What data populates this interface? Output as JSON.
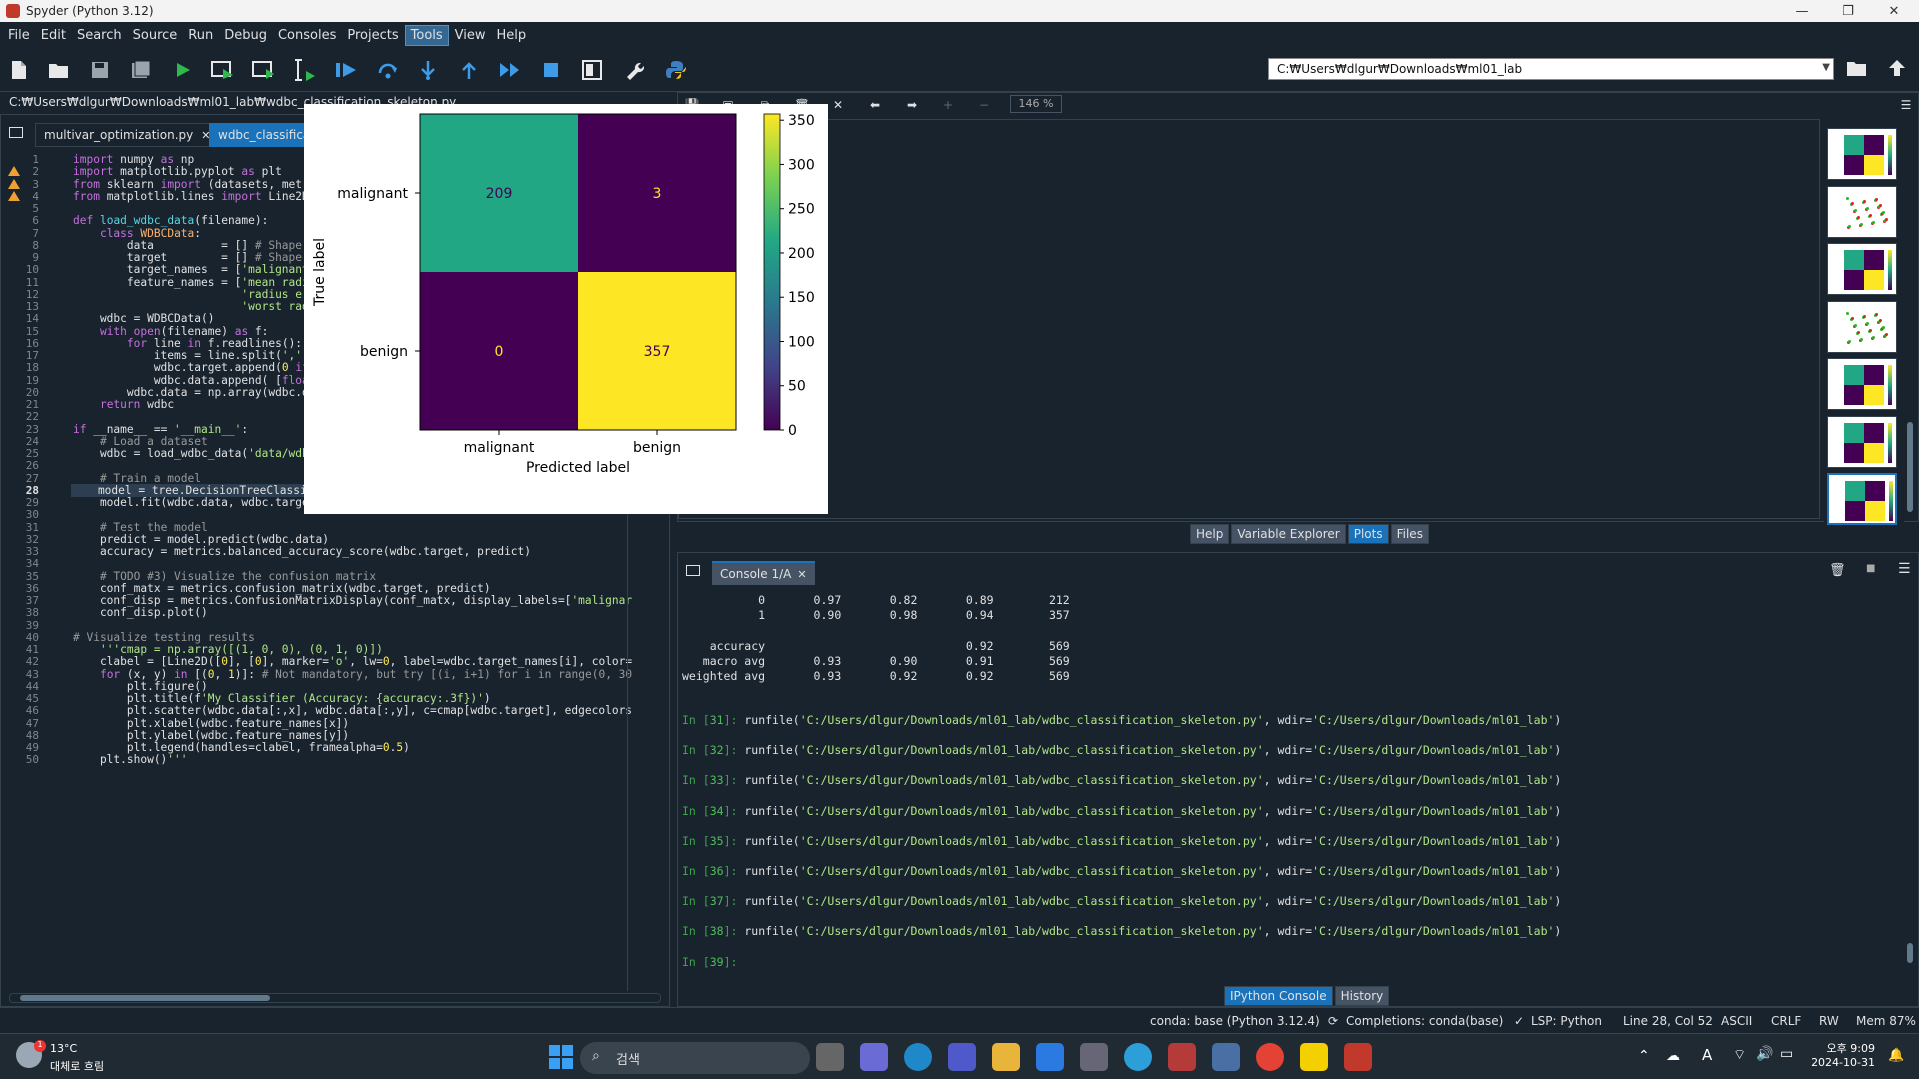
{
  "window": {
    "title": "Spyder (Python 3.12)",
    "controls": [
      "—",
      "❐",
      "✕"
    ]
  },
  "menu": [
    "File",
    "Edit",
    "Search",
    "Source",
    "Run",
    "Debug",
    "Consoles",
    "Projects",
    "Tools",
    "View",
    "Help"
  ],
  "menu_active": "Tools",
  "working_dir": "C:₩Users₩dlgur₩Downloads₩ml01_lab",
  "editor": {
    "file_path": "C:₩Users₩dlgur₩Downloads₩ml01_lab₩wdbc_classification_skeleton.py",
    "tabs": [
      {
        "label": "multivar_optimization.py",
        "active": false
      },
      {
        "label": "wdbc_classification_skeleton.py",
        "active": true
      }
    ],
    "current_line": 28
  },
  "code_lines": [
    "import numpy as np",
    "import matplotlib.pyplot as plt",
    "from sklearn import (datasets, metrics, tree)",
    "from matplotlib.lines import Line2D # For the custom legend",
    "",
    "def load_wdbc_data(filename):",
    "    class WDBCData:",
    "        data          = [] # Shape: (569, 30)",
    "        target        = [] # Shape: (569, )",
    "        target_names  = ['malignant', 'benign']",
    "        feature_names = ['mean radius', 'mean texture', 'mean perimeter', 'mean are",
    "                         'radius error', 'texture error', 'perimeter error', 'area ",
    "                         'worst radius', 'worst texture', 'worst perimeter', 'worst",
    "    wdbc = WDBCData()",
    "    with open(filename) as f:",
    "        for line in f.readlines():",
    "            items = line.split(',')",
    "            wdbc.target.append(0 if items[1]=='M' else 1)         # TODO #1) Add the",
    "            wdbc.data.append( [float(x) for x in items[2:]])         # TODO #1) Add",
    "        wdbc.data = np.array(wdbc.data)",
    "    return wdbc",
    "",
    "if __name__ == '__main__':",
    "    # Load a dataset",
    "    wdbc = load_wdbc_data('data/wdbc.data')      # TODO #1) Implement 'load_wdbc_dat",
    "",
    "    # Train a model                           # TODO #2) Find a better classifier (",
    "    model = tree.DecisionTreeClassifier(max_depth=5)",
    "    model.fit(wdbc.data, wdbc.target)",
    "",
    "    # Test the model",
    "    predict = model.predict(wdbc.data)",
    "    accuracy = metrics.balanced_accuracy_score(wdbc.target, predict)",
    "",
    "    # TODO #3) Visualize the confusion matrix",
    "    conf_matx = metrics.confusion_matrix(wdbc.target, predict)",
    "    conf_disp = metrics.ConfusionMatrixDisplay(conf_matx, display_labels=['malignar",
    "    conf_disp.plot()",
    "",
    "# Visualize testing results",
    "    '''cmap = np.array([(1, 0, 0), (0, 1, 0)])",
    "    clabel = [Line2D([0], [0], marker='o', lw=0, label=wdbc.target_names[i], color=",
    "    for (x, y) in [(0, 1)]: # Not mandatory, but try [(i, i+1) for i in range(0, 30",
    "        plt.figure()",
    "        plt.title(f'My Classifier (Accuracy: {accuracy:.3f})')",
    "        plt.scatter(wdbc.data[:,x], wdbc.data[:,y], c=cmap[wdbc.target], edgecolors",
    "        plt.xlabel(wdbc.feature_names[x])",
    "        plt.ylabel(wdbc.feature_names[y])",
    "        plt.legend(handles=clabel, framealpha=0.5)",
    "    plt.show()'''"
  ],
  "warning_lines": [
    2,
    3,
    4
  ],
  "plots": {
    "zoom": "146 %",
    "tabs": [
      "Help",
      "Variable Explorer",
      "Plots",
      "Files"
    ],
    "active_tab": "Plots"
  },
  "chart_data": {
    "type": "heatmap",
    "title": "",
    "xlabel": "Predicted label",
    "ylabel": "True label",
    "categories": [
      "malignant",
      "benign"
    ],
    "values": [
      [
        209,
        3
      ],
      [
        0,
        357
      ]
    ],
    "colorbar_ticks": [
      0,
      50,
      100,
      150,
      200,
      250,
      300,
      350
    ],
    "colormap": "viridis",
    "cell_colors": [
      [
        "#21a784",
        "#440154"
      ],
      [
        "#440154",
        "#fde725"
      ]
    ],
    "text_colors": [
      [
        "#440154",
        "#fde725"
      ],
      [
        "#fde725",
        "#440154"
      ]
    ]
  },
  "console": {
    "tab": "Console 1/A",
    "report_rows": [
      {
        "label": "0",
        "p": "0.97",
        "r": "0.82",
        "f": "0.89",
        "s": "212"
      },
      {
        "label": "1",
        "p": "0.90",
        "r": "0.98",
        "f": "0.94",
        "s": "357"
      },
      {
        "label": "",
        "p": "",
        "r": "",
        "f": "",
        "s": ""
      },
      {
        "label": "accuracy",
        "p": "",
        "r": "",
        "f": "0.92",
        "s": "569"
      },
      {
        "label": "macro avg",
        "p": "0.93",
        "r": "0.90",
        "f": "0.91",
        "s": "569"
      },
      {
        "label": "weighted avg",
        "p": "0.93",
        "r": "0.92",
        "f": "0.92",
        "s": "569"
      }
    ],
    "runs": [
      31,
      32,
      33,
      34,
      35,
      36,
      37,
      38
    ],
    "run_file": "'C:/Users/dlgur/Downloads/ml01_lab/wdbc_classification_skeleton.py'",
    "run_wdir": "'C:/Users/dlgur/Downloads/ml01_lab'",
    "prompt_num": 39,
    "bottom_tabs": [
      "IPython Console",
      "History"
    ],
    "active_bottom_tab": "IPython Console"
  },
  "status": {
    "conda": "conda: base (Python 3.12.4)",
    "completions": "Completions: conda(base)",
    "lsp": "LSP: Python",
    "position": "Line 28, Col 52",
    "encoding": "ASCII",
    "eol": "CRLF",
    "rw": "RW",
    "mem": "Mem 87%"
  },
  "taskbar": {
    "weather_temp": "13°C",
    "weather_desc": "대체로 흐림",
    "search_placeholder": "검색",
    "time": "오후 9:09",
    "date": "2024-10-31",
    "ime": "A"
  }
}
